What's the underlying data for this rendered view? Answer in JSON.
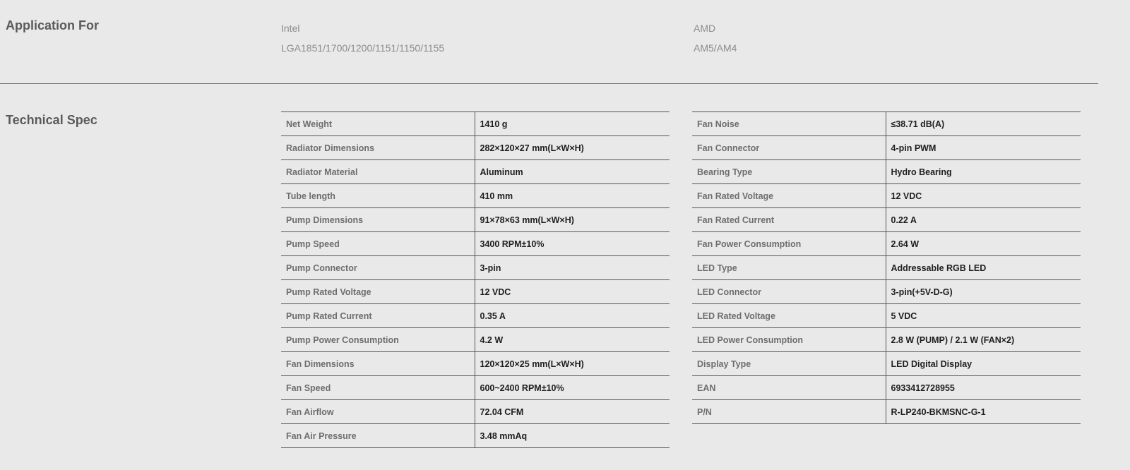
{
  "application": {
    "title": "Application For",
    "intel": {
      "label": "Intel",
      "sockets": "LGA1851/1700/1200/1151/1150/1155"
    },
    "amd": {
      "label": "AMD",
      "sockets": "AM5/AM4"
    }
  },
  "spec": {
    "title": "Technical Spec",
    "left": [
      {
        "key": "Net Weight",
        "value": "1410 g"
      },
      {
        "key": "Radiator Dimensions",
        "value": "282×120×27 mm(L×W×H)"
      },
      {
        "key": "Radiator Material",
        "value": "Aluminum"
      },
      {
        "key": "Tube length",
        "value": "410 mm"
      },
      {
        "key": "Pump Dimensions",
        "value": "91×78×63 mm(L×W×H)"
      },
      {
        "key": "Pump Speed",
        "value": "3400 RPM±10%"
      },
      {
        "key": "Pump Connector",
        "value": "3-pin"
      },
      {
        "key": "Pump Rated Voltage",
        "value": "12 VDC"
      },
      {
        "key": "Pump Rated Current",
        "value": "0.35 A"
      },
      {
        "key": "Pump Power Consumption",
        "value": "4.2 W"
      },
      {
        "key": "Fan Dimensions",
        "value": "120×120×25 mm(L×W×H)"
      },
      {
        "key": "Fan Speed",
        "value": "600~2400 RPM±10%"
      },
      {
        "key": "Fan Airflow",
        "value": "72.04 CFM"
      },
      {
        "key": "Fan Air Pressure",
        "value": "3.48 mmAq"
      }
    ],
    "right": [
      {
        "key": "Fan Noise",
        "value": "≤38.71 dB(A)"
      },
      {
        "key": "Fan Connector",
        "value": "4-pin PWM"
      },
      {
        "key": "Bearing Type",
        "value": "Hydro Bearing"
      },
      {
        "key": "Fan Rated Voltage",
        "value": "12 VDC"
      },
      {
        "key": "Fan Rated Current",
        "value": "0.22 A"
      },
      {
        "key": "Fan Power Consumption",
        "value": "2.64 W"
      },
      {
        "key": "LED Type",
        "value": "Addressable RGB LED"
      },
      {
        "key": "LED Connector",
        "value": "3-pin(+5V-D-G)"
      },
      {
        "key": "LED Rated Voltage",
        "value": "5 VDC"
      },
      {
        "key": "LED Power Consumption",
        "value": "2.8 W  (PUMP)  / 2.1 W  (FAN×2)"
      },
      {
        "key": "Display Type",
        "value": "LED Digital Display"
      },
      {
        "key": "EAN",
        "value": "6933412728955"
      },
      {
        "key": "P/N",
        "value": "R-LP240-BKMSNC-G-1"
      }
    ]
  }
}
